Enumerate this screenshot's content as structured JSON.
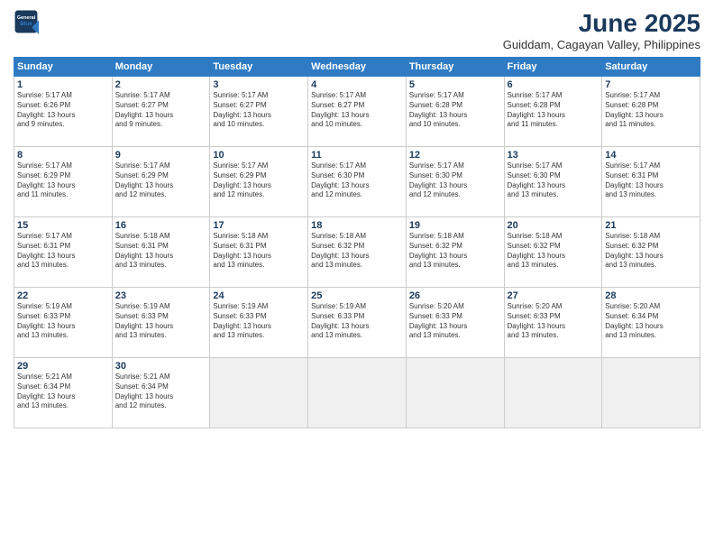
{
  "logo": {
    "line1": "General",
    "line2": "Blue"
  },
  "title": "June 2025",
  "subtitle": "Guiddam, Cagayan Valley, Philippines",
  "weekdays": [
    "Sunday",
    "Monday",
    "Tuesday",
    "Wednesday",
    "Thursday",
    "Friday",
    "Saturday"
  ],
  "weeks": [
    [
      {
        "day": 1,
        "lines": [
          "Sunrise: 5:17 AM",
          "Sunset: 6:26 PM",
          "Daylight: 13 hours",
          "and 9 minutes."
        ]
      },
      {
        "day": 2,
        "lines": [
          "Sunrise: 5:17 AM",
          "Sunset: 6:27 PM",
          "Daylight: 13 hours",
          "and 9 minutes."
        ]
      },
      {
        "day": 3,
        "lines": [
          "Sunrise: 5:17 AM",
          "Sunset: 6:27 PM",
          "Daylight: 13 hours",
          "and 10 minutes."
        ]
      },
      {
        "day": 4,
        "lines": [
          "Sunrise: 5:17 AM",
          "Sunset: 6:27 PM",
          "Daylight: 13 hours",
          "and 10 minutes."
        ]
      },
      {
        "day": 5,
        "lines": [
          "Sunrise: 5:17 AM",
          "Sunset: 6:28 PM",
          "Daylight: 13 hours",
          "and 10 minutes."
        ]
      },
      {
        "day": 6,
        "lines": [
          "Sunrise: 5:17 AM",
          "Sunset: 6:28 PM",
          "Daylight: 13 hours",
          "and 11 minutes."
        ]
      },
      {
        "day": 7,
        "lines": [
          "Sunrise: 5:17 AM",
          "Sunset: 6:28 PM",
          "Daylight: 13 hours",
          "and 11 minutes."
        ]
      }
    ],
    [
      {
        "day": 8,
        "lines": [
          "Sunrise: 5:17 AM",
          "Sunset: 6:29 PM",
          "Daylight: 13 hours",
          "and 11 minutes."
        ]
      },
      {
        "day": 9,
        "lines": [
          "Sunrise: 5:17 AM",
          "Sunset: 6:29 PM",
          "Daylight: 13 hours",
          "and 12 minutes."
        ]
      },
      {
        "day": 10,
        "lines": [
          "Sunrise: 5:17 AM",
          "Sunset: 6:29 PM",
          "Daylight: 13 hours",
          "and 12 minutes."
        ]
      },
      {
        "day": 11,
        "lines": [
          "Sunrise: 5:17 AM",
          "Sunset: 6:30 PM",
          "Daylight: 13 hours",
          "and 12 minutes."
        ]
      },
      {
        "day": 12,
        "lines": [
          "Sunrise: 5:17 AM",
          "Sunset: 6:30 PM",
          "Daylight: 13 hours",
          "and 12 minutes."
        ]
      },
      {
        "day": 13,
        "lines": [
          "Sunrise: 5:17 AM",
          "Sunset: 6:30 PM",
          "Daylight: 13 hours",
          "and 13 minutes."
        ]
      },
      {
        "day": 14,
        "lines": [
          "Sunrise: 5:17 AM",
          "Sunset: 6:31 PM",
          "Daylight: 13 hours",
          "and 13 minutes."
        ]
      }
    ],
    [
      {
        "day": 15,
        "lines": [
          "Sunrise: 5:17 AM",
          "Sunset: 6:31 PM",
          "Daylight: 13 hours",
          "and 13 minutes."
        ]
      },
      {
        "day": 16,
        "lines": [
          "Sunrise: 5:18 AM",
          "Sunset: 6:31 PM",
          "Daylight: 13 hours",
          "and 13 minutes."
        ]
      },
      {
        "day": 17,
        "lines": [
          "Sunrise: 5:18 AM",
          "Sunset: 6:31 PM",
          "Daylight: 13 hours",
          "and 13 minutes."
        ]
      },
      {
        "day": 18,
        "lines": [
          "Sunrise: 5:18 AM",
          "Sunset: 6:32 PM",
          "Daylight: 13 hours",
          "and 13 minutes."
        ]
      },
      {
        "day": 19,
        "lines": [
          "Sunrise: 5:18 AM",
          "Sunset: 6:32 PM",
          "Daylight: 13 hours",
          "and 13 minutes."
        ]
      },
      {
        "day": 20,
        "lines": [
          "Sunrise: 5:18 AM",
          "Sunset: 6:32 PM",
          "Daylight: 13 hours",
          "and 13 minutes."
        ]
      },
      {
        "day": 21,
        "lines": [
          "Sunrise: 5:18 AM",
          "Sunset: 6:32 PM",
          "Daylight: 13 hours",
          "and 13 minutes."
        ]
      }
    ],
    [
      {
        "day": 22,
        "lines": [
          "Sunrise: 5:19 AM",
          "Sunset: 6:33 PM",
          "Daylight: 13 hours",
          "and 13 minutes."
        ]
      },
      {
        "day": 23,
        "lines": [
          "Sunrise: 5:19 AM",
          "Sunset: 6:33 PM",
          "Daylight: 13 hours",
          "and 13 minutes."
        ]
      },
      {
        "day": 24,
        "lines": [
          "Sunrise: 5:19 AM",
          "Sunset: 6:33 PM",
          "Daylight: 13 hours",
          "and 13 minutes."
        ]
      },
      {
        "day": 25,
        "lines": [
          "Sunrise: 5:19 AM",
          "Sunset: 6:33 PM",
          "Daylight: 13 hours",
          "and 13 minutes."
        ]
      },
      {
        "day": 26,
        "lines": [
          "Sunrise: 5:20 AM",
          "Sunset: 6:33 PM",
          "Daylight: 13 hours",
          "and 13 minutes."
        ]
      },
      {
        "day": 27,
        "lines": [
          "Sunrise: 5:20 AM",
          "Sunset: 6:33 PM",
          "Daylight: 13 hours",
          "and 13 minutes."
        ]
      },
      {
        "day": 28,
        "lines": [
          "Sunrise: 5:20 AM",
          "Sunset: 6:34 PM",
          "Daylight: 13 hours",
          "and 13 minutes."
        ]
      }
    ],
    [
      {
        "day": 29,
        "lines": [
          "Sunrise: 5:21 AM",
          "Sunset: 6:34 PM",
          "Daylight: 13 hours",
          "and 13 minutes."
        ]
      },
      {
        "day": 30,
        "lines": [
          "Sunrise: 5:21 AM",
          "Sunset: 6:34 PM",
          "Daylight: 13 hours",
          "and 12 minutes."
        ]
      },
      null,
      null,
      null,
      null,
      null
    ]
  ]
}
